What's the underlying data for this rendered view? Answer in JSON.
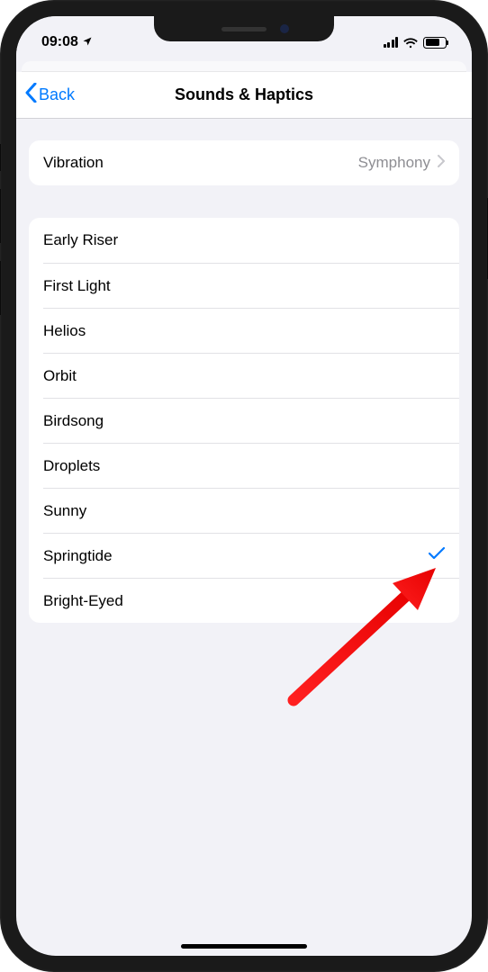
{
  "status": {
    "time": "09:08",
    "location_icon": "location-arrow"
  },
  "nav": {
    "back_label": "Back",
    "title": "Sounds & Haptics"
  },
  "vibration_row": {
    "label": "Vibration",
    "value": "Symphony"
  },
  "sounds": [
    {
      "label": "Early Riser",
      "selected": false
    },
    {
      "label": "First Light",
      "selected": false
    },
    {
      "label": "Helios",
      "selected": false
    },
    {
      "label": "Orbit",
      "selected": false
    },
    {
      "label": "Birdsong",
      "selected": false
    },
    {
      "label": "Droplets",
      "selected": false
    },
    {
      "label": "Sunny",
      "selected": false
    },
    {
      "label": "Springtide",
      "selected": true
    },
    {
      "label": "Bright-Eyed",
      "selected": false
    }
  ],
  "colors": {
    "tint": "#007aff",
    "background": "#f2f2f7",
    "separator": "#e2e2e5",
    "secondary_label": "#8e8e93"
  }
}
